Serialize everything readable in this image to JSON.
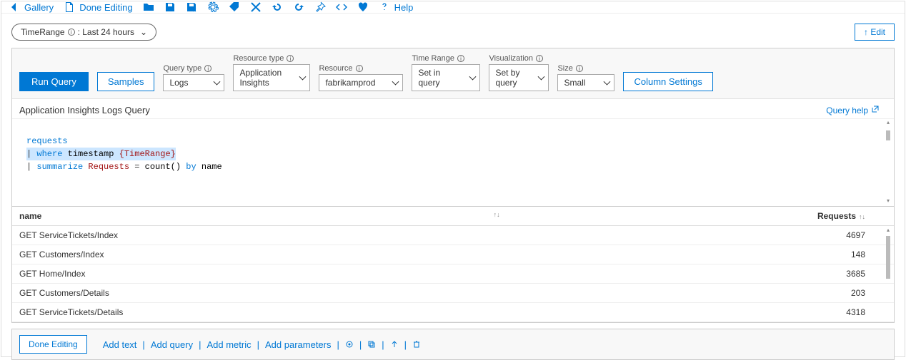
{
  "toolbar": {
    "gallery": "Gallery",
    "done_editing": "Done Editing",
    "help": "Help"
  },
  "param_pill": {
    "name": "TimeRange",
    "value": ": Last 24 hours"
  },
  "edit_btn": "↑ Edit",
  "query_panel": {
    "run": "Run Query",
    "samples": "Samples",
    "column_settings": "Column Settings",
    "fields": {
      "query_type": {
        "label": "Query type",
        "value": "Logs"
      },
      "resource_type": {
        "label": "Resource type",
        "value": "Application Insights"
      },
      "resource": {
        "label": "Resource",
        "value": "fabrikamprod"
      },
      "time_range": {
        "label": "Time Range",
        "value": "Set in query"
      },
      "visualization": {
        "label": "Visualization",
        "value": "Set by query"
      },
      "size": {
        "label": "Size",
        "value": "Small"
      }
    },
    "title": "Application Insights Logs Query",
    "query_help": "Query help",
    "code": {
      "l1": "requests",
      "l2_kw": "where",
      "l2_ident": "timestamp",
      "l2_param": "{TimeRange}",
      "l3_kw": "summarize",
      "l3_attr": "Requests",
      "l3_eq": " = ",
      "l3_fn": "count()",
      "l3_by": " by ",
      "l3_col": "name"
    }
  },
  "table": {
    "col_name": "name",
    "col_requests": "Requests",
    "rows": [
      {
        "name": "GET ServiceTickets/Index",
        "requests": "4697"
      },
      {
        "name": "GET Customers/Index",
        "requests": "148"
      },
      {
        "name": "GET Home/Index",
        "requests": "3685"
      },
      {
        "name": "GET Customers/Details",
        "requests": "203"
      },
      {
        "name": "GET ServiceTickets/Details",
        "requests": "4318"
      }
    ]
  },
  "footer": {
    "done_editing": "Done Editing",
    "add_text": "Add text",
    "add_query": "Add query",
    "add_metric": "Add metric",
    "add_parameters": "Add parameters"
  }
}
